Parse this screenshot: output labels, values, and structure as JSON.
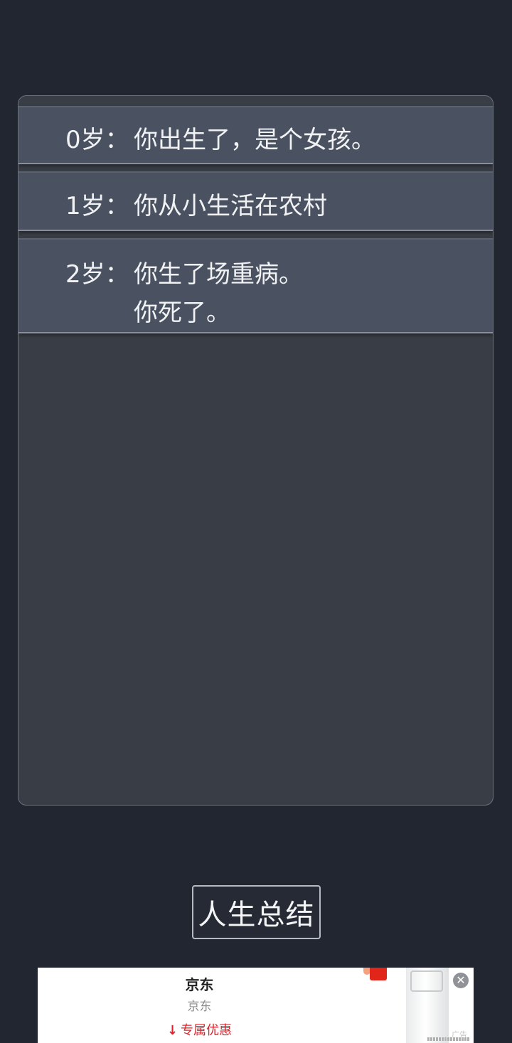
{
  "life_log": [
    {
      "age": "0岁：",
      "events": [
        "你出生了，是个女孩。"
      ]
    },
    {
      "age": "1岁：",
      "events": [
        "你从小生活在农村"
      ]
    },
    {
      "age": "2岁：",
      "events": [
        "你生了场重病。",
        "你死了。"
      ]
    }
  ],
  "summary_button": {
    "label": "人生总结"
  },
  "ad": {
    "title": "京东",
    "subtitle": "京东",
    "cta": "专属优惠",
    "cta_icon": "download-arrow-icon",
    "close_icon": "close-icon",
    "badge": "广告",
    "colors": {
      "cta": "#e0232a",
      "logo": "#e1251b"
    }
  },
  "colors": {
    "background": "#222631",
    "panel": "#393d46",
    "entry": "#4a5261",
    "text": "#f1f2f4"
  }
}
